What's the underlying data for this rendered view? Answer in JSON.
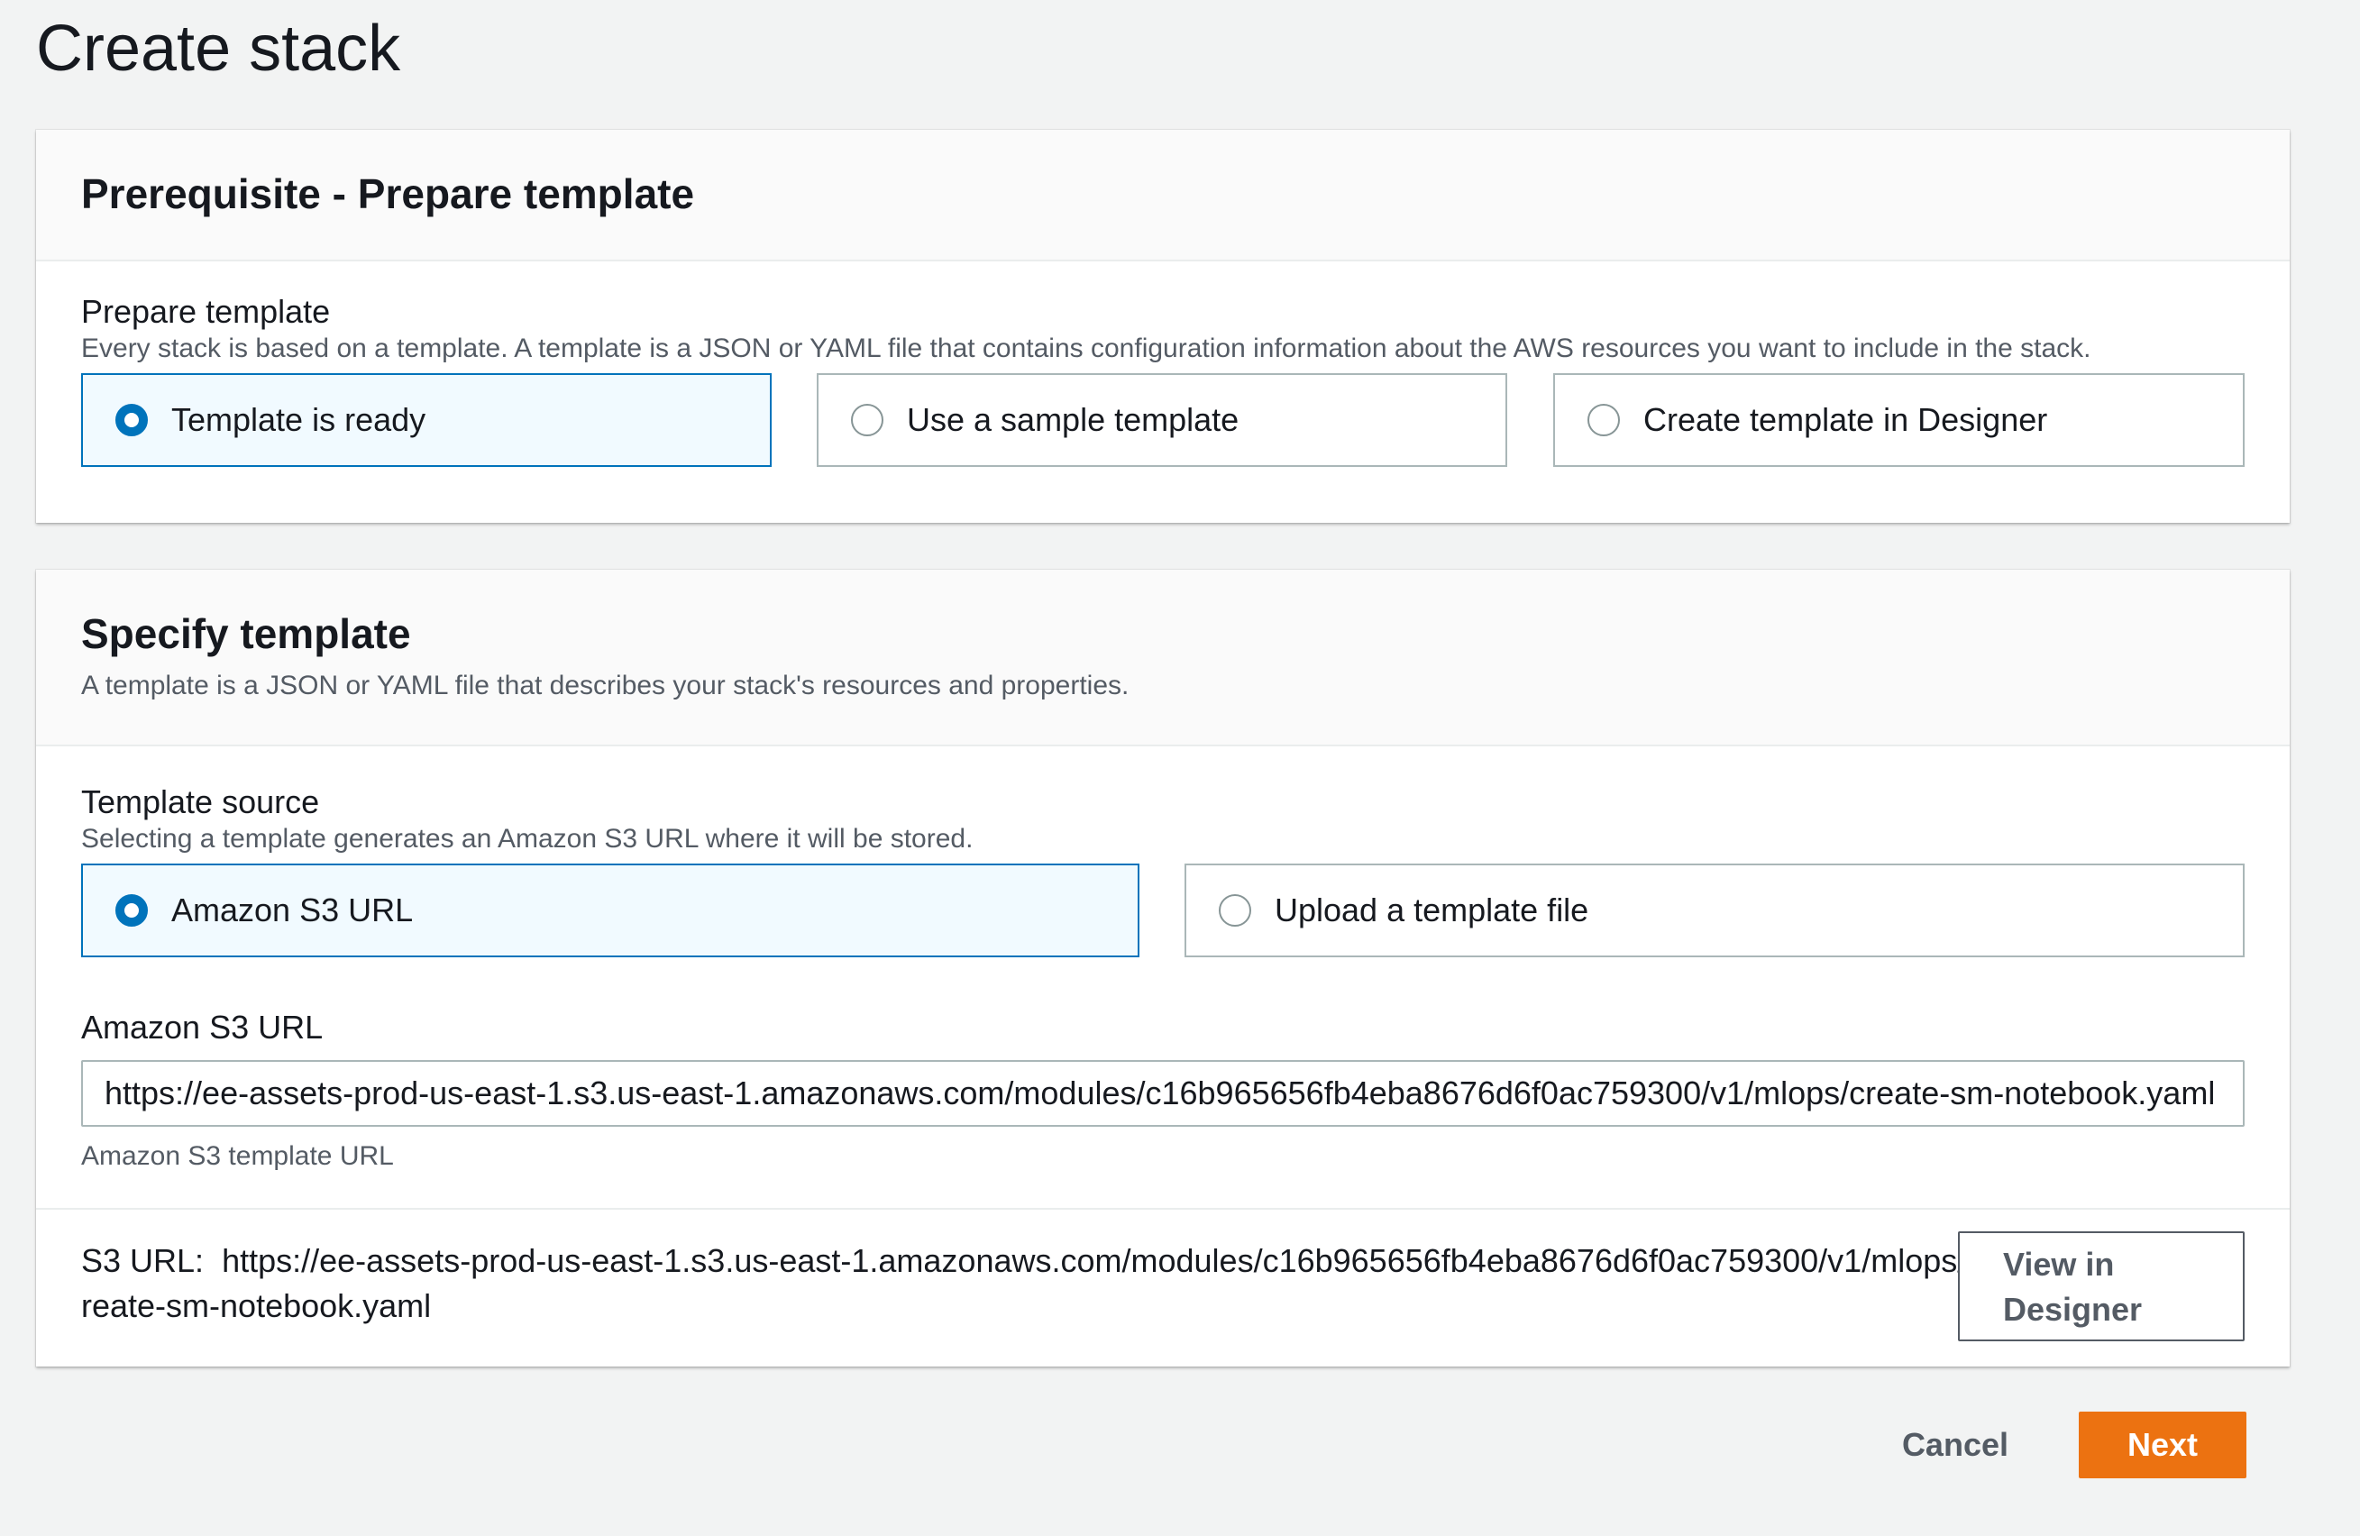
{
  "page": {
    "title": "Create stack"
  },
  "prepare_panel": {
    "title": "Prerequisite - Prepare template",
    "field_label": "Prepare template",
    "field_description": "Every stack is based on a template. A template is a JSON or YAML file that contains configuration information about the AWS resources you want to include in the stack.",
    "options": [
      {
        "label": "Template is ready",
        "selected": true
      },
      {
        "label": "Use a sample template",
        "selected": false
      },
      {
        "label": "Create template in Designer",
        "selected": false
      }
    ]
  },
  "specify_panel": {
    "title": "Specify template",
    "description": "A template is a JSON or YAML file that describes your stack's resources and properties.",
    "source_label": "Template source",
    "source_description": "Selecting a template generates an Amazon S3 URL where it will be stored.",
    "source_options": [
      {
        "label": "Amazon S3 URL",
        "selected": true
      },
      {
        "label": "Upload a template file",
        "selected": false
      }
    ],
    "url_label": "Amazon S3 URL",
    "url_value": "https://ee-assets-prod-us-east-1.s3.us-east-1.amazonaws.com/modules/c16b965656fb4eba8676d6f0ac759300/v1/mlops/create-sm-notebook.yaml",
    "url_constraint": "Amazon S3 template URL",
    "s3_url_prefix": "S3 URL:",
    "s3_url_value": "https://ee-assets-prod-us-east-1.s3.us-east-1.amazonaws.com/modules/c16b965656fb4eba8676d6f0ac759300/v1/mlops/create-sm-notebook.yaml",
    "view_designer_label": "View in Designer"
  },
  "actions": {
    "cancel_label": "Cancel",
    "next_label": "Next"
  },
  "colors": {
    "primary_button": "#ec7211",
    "selected_radio": "#0073bb",
    "selected_tile_bg": "#f1faff",
    "page_bg": "#f2f3f3"
  }
}
